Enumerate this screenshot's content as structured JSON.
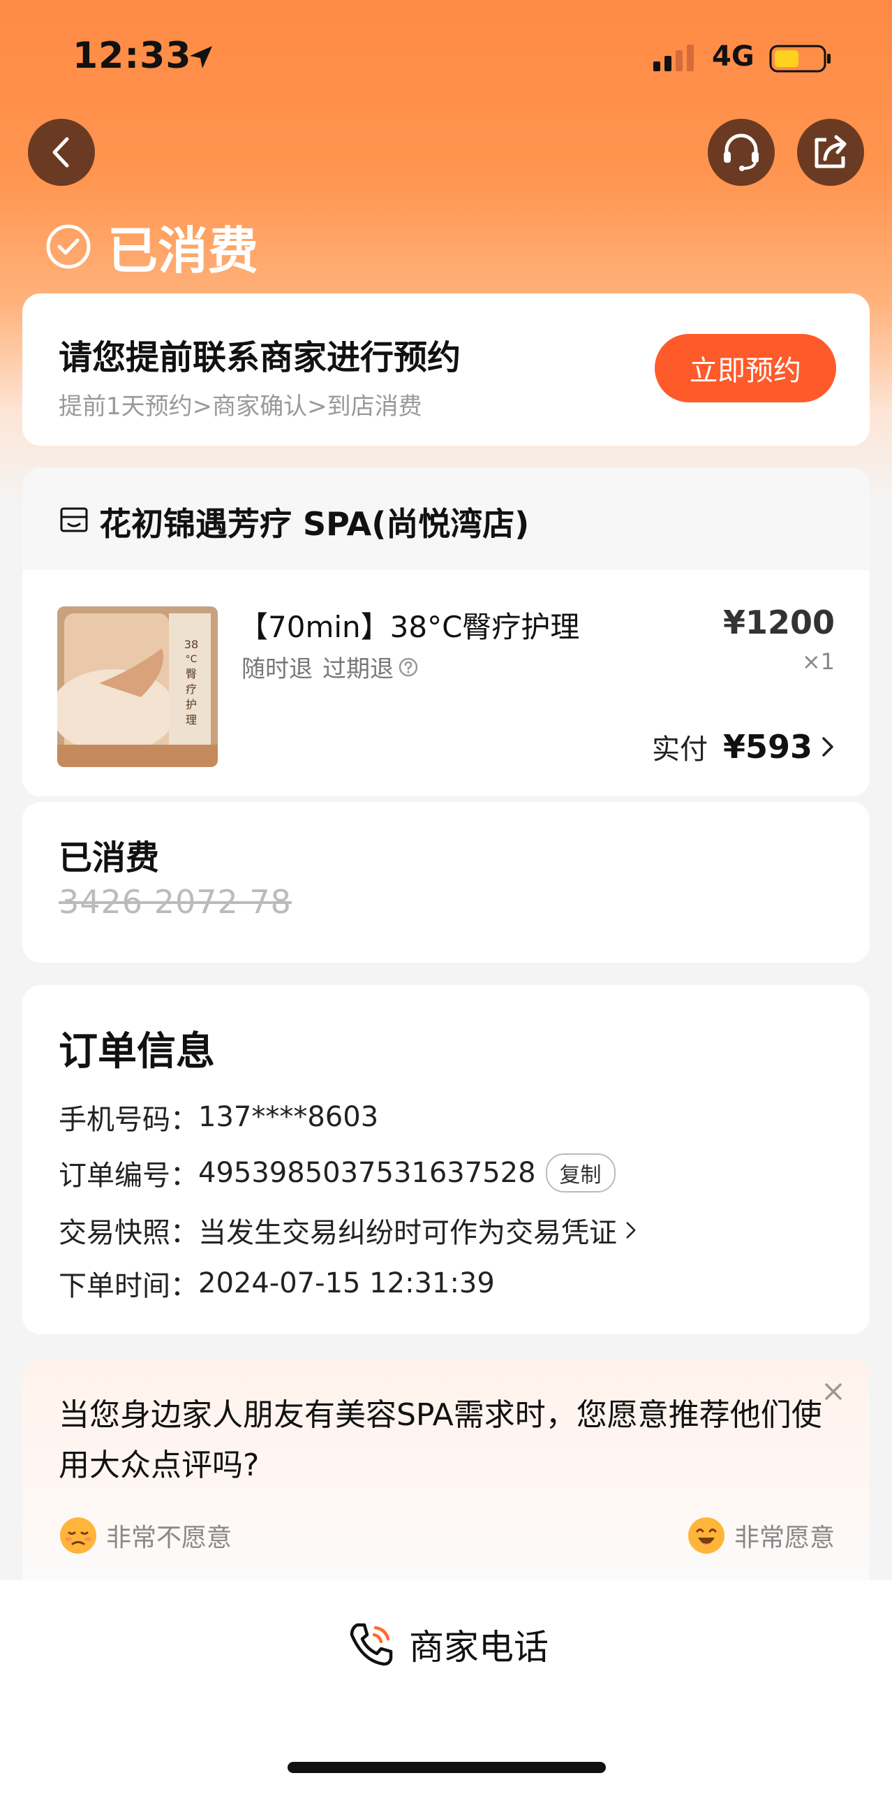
{
  "status_bar": {
    "time": "12:33",
    "network": "4G",
    "icons": [
      "location-arrow-icon",
      "signal-icon",
      "battery-icon"
    ]
  },
  "header": {
    "status_title": "已消费",
    "icons": [
      "back-icon",
      "customer-service-icon",
      "share-icon",
      "check-circle-icon"
    ]
  },
  "booking": {
    "title": "请您提前联系商家进行预约",
    "subtitle": "提前1天预约>商家确认>到店消费",
    "button_label": "立即预约"
  },
  "shop": {
    "name": "花初锦遇芳疗 SPA(尚悦湾店)",
    "icon": "shop-icon",
    "product": {
      "title": "【70min】38°C臀疗护理",
      "tag_refund": "随时退",
      "tag_expire": "过期退",
      "price": "¥1200",
      "quantity": "×1",
      "paid_label": "实付",
      "paid_value": "¥593",
      "image_text": "38°C 臀疗护理"
    }
  },
  "voucher": {
    "title": "已消费",
    "code": "3426 2072 78"
  },
  "order": {
    "title": "订单信息",
    "phone_label": "手机号码：",
    "phone_value": "137****8603",
    "order_no_label": "订单编号：",
    "order_no_value": "4953985037531637528",
    "copy_label": "复制",
    "snapshot_label": "交易快照：",
    "snapshot_value": "当发生交易纠纷时可作为交易凭证",
    "time_label": "下单时间：",
    "time_value": "2024-07-15 12:31:39"
  },
  "survey": {
    "question": "当您身边家人朋友有美容SPA需求时，您愿意推荐他们使用大众点评吗?",
    "option_no": "非常不愿意",
    "option_yes": "非常愿意"
  },
  "bottom": {
    "phone_button": "商家电话"
  },
  "colors": {
    "accent": "#ff5a2a",
    "header_gradient_top": "#ff8a45",
    "icon_button_bg": "#6b3a22"
  }
}
